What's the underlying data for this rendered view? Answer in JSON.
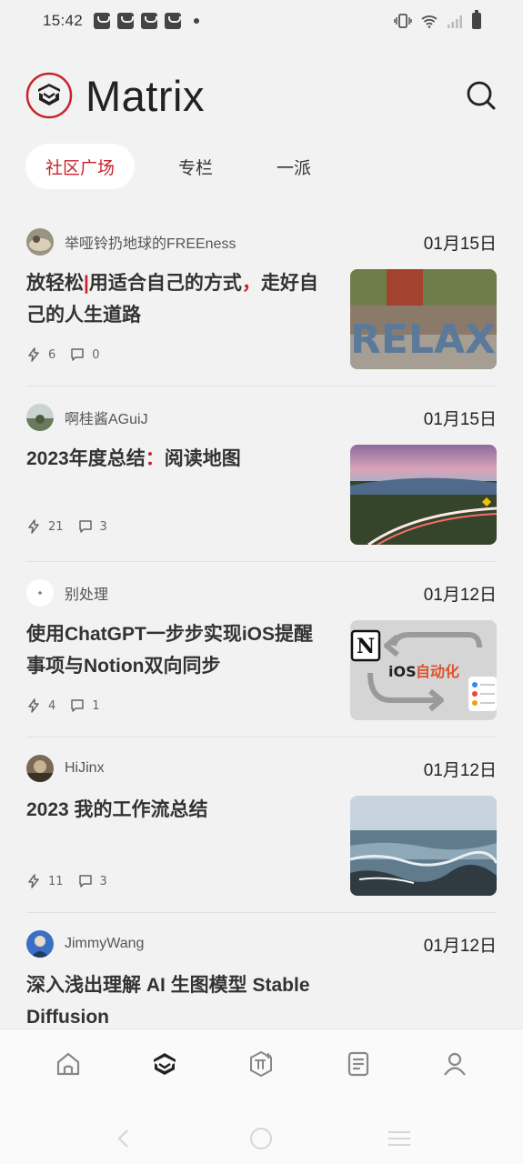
{
  "status_bar": {
    "time": "15:42"
  },
  "header": {
    "brand": "Matrix",
    "logo_color": "#c8232c"
  },
  "tabs": [
    {
      "label": "社区广场",
      "active": true
    },
    {
      "label": "专栏",
      "active": false
    },
    {
      "label": "一派",
      "active": false
    }
  ],
  "posts": [
    {
      "author": "举哑铃扔地球的FREEness",
      "date": "01月15日",
      "title_a": "放轻松",
      "title_b": "用适合自己的方式",
      "title_c": "走好自己的人生道路",
      "likes": "6",
      "comments": "0",
      "thumb_text": "RELAX"
    },
    {
      "author": "啊桂酱AGuiJ",
      "date": "01月15日",
      "title_a": "2023年度总结",
      "title_b": "阅读地图",
      "likes": "21",
      "comments": "3"
    },
    {
      "author": "别处理",
      "date": "01月12日",
      "title": "使用ChatGPT一步步实现iOS提醒事项与Notion双向同步",
      "likes": "4",
      "comments": "1",
      "thumb_text_a": "iOS",
      "thumb_text_b": "自动化"
    },
    {
      "author": "HiJinx",
      "date": "01月12日",
      "title": "2023 我的工作流总结",
      "likes": "11",
      "comments": "3"
    },
    {
      "author": "JimmyWang",
      "date": "01月12日",
      "title": "深入浅出理解 AI 生图模型 Stable Diffusion"
    }
  ],
  "colors": {
    "accent": "#c8232c",
    "background": "#f2f2f3"
  }
}
